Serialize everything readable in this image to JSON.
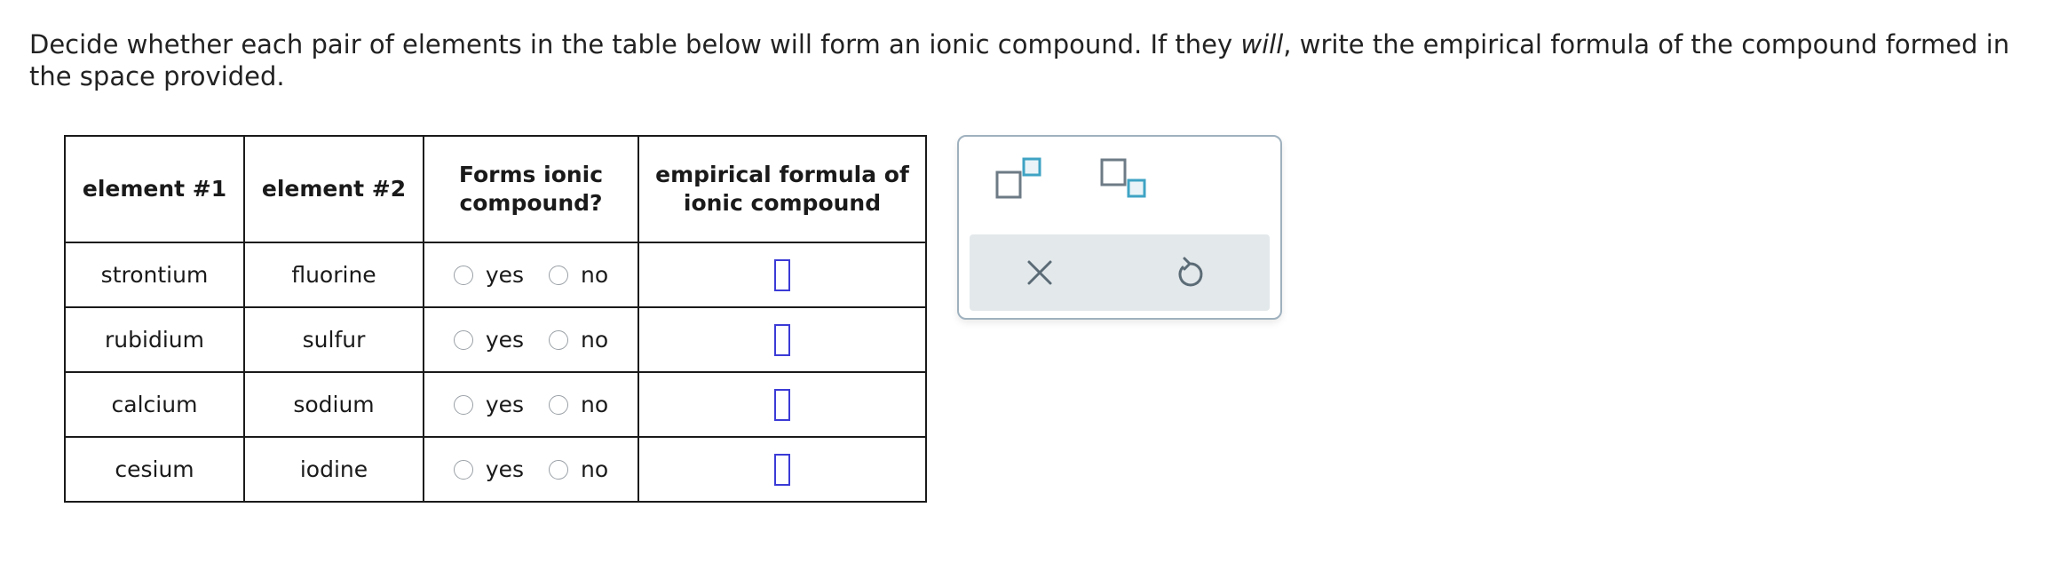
{
  "prompt": {
    "part1": "Decide whether each pair of elements in the table below will form an ionic compound. If they ",
    "emphasis": "will",
    "part2": ", write the empirical formula of the compound formed in the space provided."
  },
  "table": {
    "headers": {
      "element1": "element #1",
      "element2": "element #2",
      "forms_line1": "Forms ionic",
      "forms_line2": "compound?",
      "formula_line1": "empirical formula of",
      "formula_line2": "ionic compound"
    },
    "yes_label": "yes",
    "no_label": "no",
    "rows": [
      {
        "element1": "strontium",
        "element2": "fluorine"
      },
      {
        "element1": "rubidium",
        "element2": "sulfur"
      },
      {
        "element1": "calcium",
        "element2": "sodium"
      },
      {
        "element1": "cesium",
        "element2": "iodine"
      }
    ]
  },
  "toolbox": {
    "icons": [
      "superscript-icon",
      "subscript-icon",
      "close-icon",
      "undo-icon"
    ],
    "accent_color": "#3fa3c4",
    "box_color": "#6d7b86"
  },
  "colors": {
    "answer_box": "#3b3bd6",
    "toolbar_bg": "#e3e8eb",
    "toolbox_border": "#9fb1be"
  }
}
